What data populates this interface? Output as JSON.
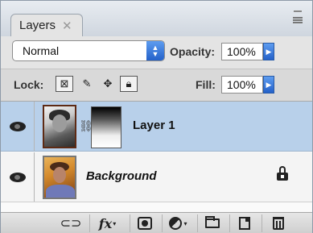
{
  "tab": {
    "label": "Layers",
    "close_glyph": "✕"
  },
  "blend": {
    "mode": "Normal"
  },
  "opacity": {
    "label": "Opacity:",
    "value": "100%"
  },
  "lock": {
    "label": "Lock:"
  },
  "fill": {
    "label": "Fill:",
    "value": "100%"
  },
  "layers": [
    {
      "name": "Layer 1",
      "selected": true,
      "has_mask": true
    },
    {
      "name": "Background",
      "selected": false,
      "locked": true
    }
  ],
  "bottom_tools": [
    "link-layers-icon",
    "fx-icon",
    "add-mask-icon",
    "adjustment-layer-icon",
    "new-group-icon",
    "new-layer-icon",
    "delete-layer-icon"
  ],
  "fx_label": "fx",
  "colors": {
    "selected_row": "#b8d0ea",
    "accent_blue": "#2461c9"
  }
}
